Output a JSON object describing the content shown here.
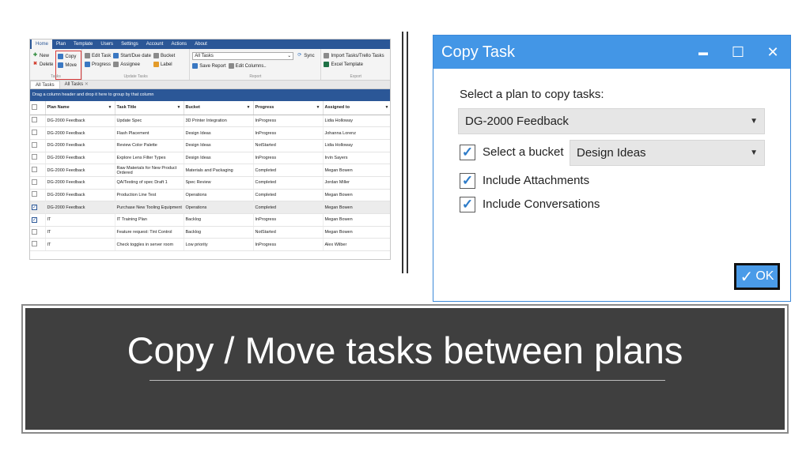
{
  "app": {
    "menu": [
      "Home",
      "Plan",
      "Template",
      "Users",
      "Settings",
      "Account",
      "Actions",
      "About"
    ],
    "ribbon": {
      "tasks_group": {
        "new": "New",
        "delete": "Delete",
        "copy": "Copy",
        "move": "Move",
        "name": "Tasks"
      },
      "update_group": {
        "edit_task": "Edit Task",
        "progress": "Progress",
        "start_due": "Start/Due date",
        "assignee": "Assignee",
        "bucket": "Bucket",
        "label": "Label",
        "name": "Update Tasks"
      },
      "report_group": {
        "view_select": "All Tasks",
        "sync": "Sync",
        "save_report": "Save Report",
        "edit_columns": "Edit Columns..",
        "name": "Report"
      },
      "export_group": {
        "import": "Import Tasks/Trello Tasks",
        "excel": "Excel Template",
        "name": "Export"
      }
    },
    "tabs": [
      "All Tasks",
      "All Tasks"
    ],
    "group_hint": "Drag a column header and drop it here to group by that column",
    "columns": [
      "Plan Name",
      "Task Title",
      "Bucket",
      "Progress",
      "Assigned to"
    ],
    "rows": [
      {
        "checked": false,
        "sel": false,
        "plan": "DG-2000 Feedback",
        "title": "Update Spec",
        "bucket": "3D Printer Integration",
        "progress": "InProgress",
        "assigned": "Lidia Holloway"
      },
      {
        "checked": false,
        "sel": false,
        "plan": "DG-2000 Feedback",
        "title": "Flash Placement",
        "bucket": "Design Ideas",
        "progress": "InProgress",
        "assigned": "Johanna Lorenz"
      },
      {
        "checked": false,
        "sel": false,
        "plan": "DG-2000 Feedback",
        "title": "Review Color Palette",
        "bucket": "Design Ideas",
        "progress": "NotStarted",
        "assigned": "Lidia Holloway"
      },
      {
        "checked": false,
        "sel": false,
        "plan": "DG-2000 Feedback",
        "title": "Explore Lens Filter Types",
        "bucket": "Design Ideas",
        "progress": "InProgress",
        "assigned": "Irvin Sayers"
      },
      {
        "checked": false,
        "sel": false,
        "plan": "DG-2000 Feedback",
        "title": "Raw Materials for New Product Ordered",
        "bucket": "Materials and Packaging",
        "progress": "Completed",
        "assigned": "Megan Bowen"
      },
      {
        "checked": false,
        "sel": false,
        "plan": "DG-2000 Feedback",
        "title": "QA/Testing of spec Draft 1",
        "bucket": "Spec Review",
        "progress": "Completed",
        "assigned": "Jordan Miller"
      },
      {
        "checked": false,
        "sel": false,
        "plan": "DG-2000 Feedback",
        "title": "Production Line Test",
        "bucket": "Operations",
        "progress": "Completed",
        "assigned": "Megan Bowen"
      },
      {
        "checked": true,
        "sel": true,
        "plan": "DG-2000 Feedback",
        "title": "Purchase New Tooling Equipment",
        "bucket": "Operations",
        "progress": "Completed",
        "assigned": "Megan Bowen"
      },
      {
        "checked": true,
        "sel": false,
        "plan": "IT",
        "title": "IT Training Plan",
        "bucket": "Backlog",
        "progress": "InProgress",
        "assigned": "Megan Bowen"
      },
      {
        "checked": false,
        "sel": false,
        "plan": "IT",
        "title": "Feature request: Tint Control",
        "bucket": "Backlog",
        "progress": "NotStarted",
        "assigned": "Megan Bowen"
      },
      {
        "checked": false,
        "sel": false,
        "plan": "IT",
        "title": "Check toggles in server room",
        "bucket": "Low priority",
        "progress": "InProgress",
        "assigned": "Alex Wilber"
      }
    ]
  },
  "dialog": {
    "title": "Copy Task",
    "minimize": "▬",
    "maximize": "☐",
    "close": "✕",
    "plan_label": "Select a plan to copy tasks:",
    "plan_value": "DG-2000 Feedback",
    "bucket_label": "Select a bucket",
    "bucket_value": "Design Ideas",
    "attachments_label": "Include Attachments",
    "conversations_label": "Include Conversations",
    "ok_label": "OK",
    "check_mark": "✓"
  },
  "banner": {
    "title": "Copy / Move tasks between plans"
  },
  "colors": {
    "app_blue": "#2b5797",
    "dialog_blue": "#4396e6",
    "banner_bg": "#3f3f3f",
    "highlight_red": "#d93b3b"
  }
}
